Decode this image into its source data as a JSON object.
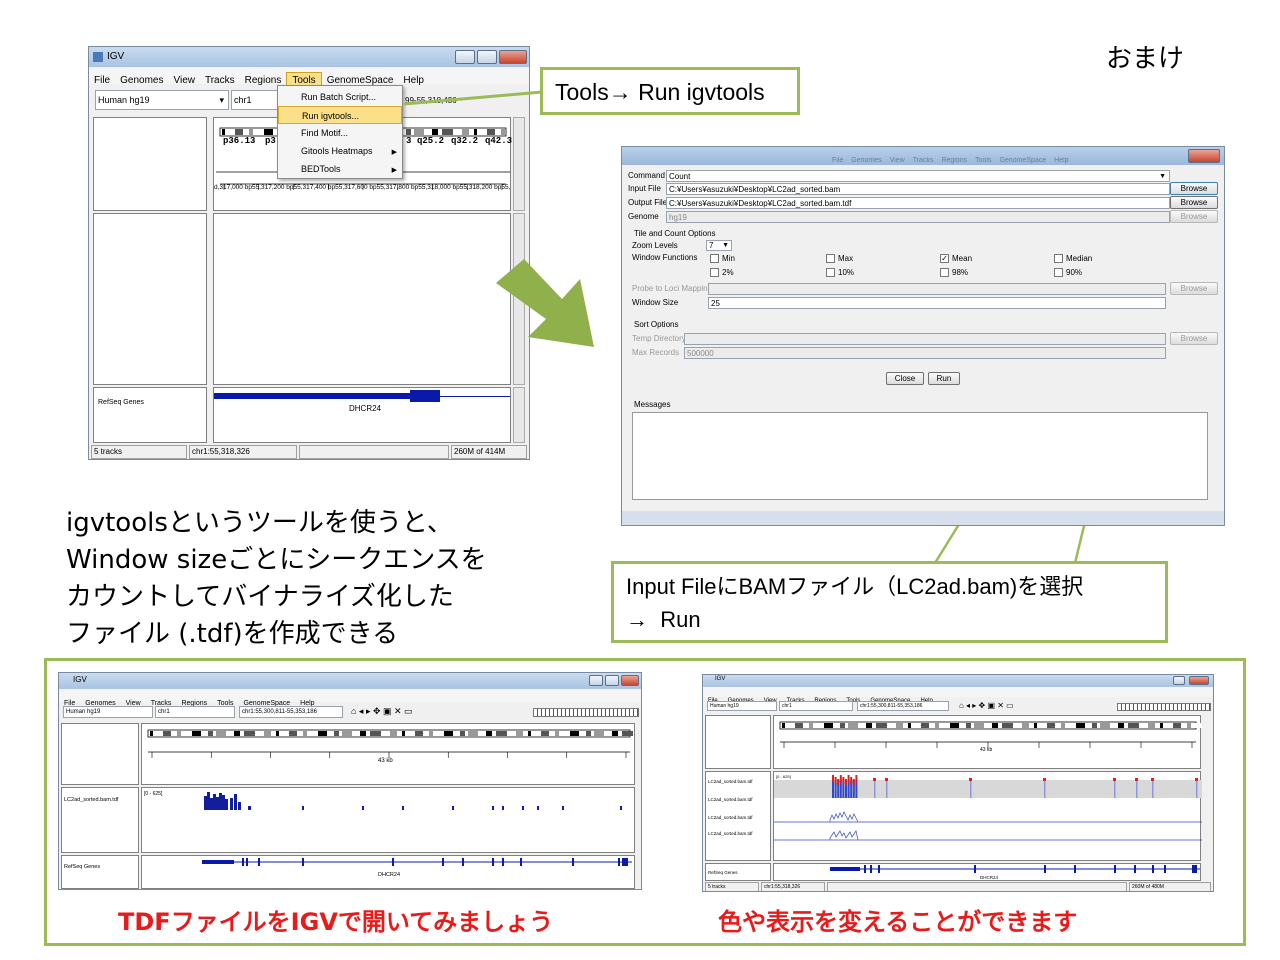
{
  "corner_label": "おまけ",
  "igv": {
    "title": "IGV",
    "menu": [
      "File",
      "Genomes",
      "View",
      "Tracks",
      "Regions",
      "Tools",
      "GenomeSpace",
      "Help"
    ],
    "genome": "Human hg19",
    "chrom": "chr1",
    "locus_partial": "99-55,318,436",
    "tools_menu": [
      "Run Batch Script...",
      "Run igvtools...",
      "Find Motif...",
      "Gitools Heatmaps",
      "BEDTools"
    ],
    "cyto_bands": [
      "p36.13",
      "p3",
      "3",
      "q25.2",
      "q32.2",
      "q42.3"
    ],
    "ruler_text": "d,317,000 bp55,317,200 bp55,317,400 bp55,317,600 bp55,317,800 bp55,318,000 bp55,318,200 bp55,318,40",
    "refseq_label": "RefSeq Genes",
    "gene": "DHCR24",
    "status": [
      "5 tracks",
      "chr1:55,318,326",
      "",
      "260M of 414M"
    ]
  },
  "callout_tools": "Tools→ Run igvtools",
  "dialog": {
    "bg_menu": [
      "File",
      "Genomes",
      "View",
      "Tracks",
      "Regions",
      "Tools",
      "GenomeSpace",
      "Help"
    ],
    "command_label": "Command",
    "command_value": "Count",
    "input_label": "Input File",
    "input_value": "C:¥Users¥asuzuki¥Desktop¥LC2ad_sorted.bam",
    "output_label": "Output File",
    "output_value": "C:¥Users¥asuzuki¥Desktop¥LC2ad_sorted.bam.tdf",
    "genome_label": "Genome",
    "genome_value": "hg19",
    "browse": "Browse",
    "tile_header": "Tile and Count Options",
    "zoom_label": "Zoom Levels",
    "zoom_value": "7",
    "window_functions_label": "Window Functions",
    "functions": [
      {
        "label": "Min",
        "checked": false
      },
      {
        "label": "Max",
        "checked": false
      },
      {
        "label": "Mean",
        "checked": true
      },
      {
        "label": "Median",
        "checked": false
      },
      {
        "label": "2%",
        "checked": false
      },
      {
        "label": "10%",
        "checked": false
      },
      {
        "label": "98%",
        "checked": false
      },
      {
        "label": "90%",
        "checked": false
      }
    ],
    "probe_label": "Probe to Loci Mapping",
    "window_size_label": "Window Size",
    "window_size_value": "25",
    "sort_header": "Sort Options",
    "temp_label": "Temp Directory",
    "maxrec_label": "Max Records",
    "maxrec_value": "500000",
    "close": "Close",
    "run": "Run",
    "messages_label": "Messages"
  },
  "description": "igvtoolsというツールを使うと、\nWindow sizeごとにシークエンスを\nカウントしてバイナライズ化した\nファイル (.tdf)を作成できる",
  "callout_input": "Input FileにBAMファイル（LC2ad.bam)を選択\n→  Run",
  "igv2": {
    "title": "IGV",
    "genome": "Human hg19",
    "chrom": "chr1",
    "locus": "chr1:55,300,811-55,353,186",
    "size_label": "43 kb",
    "track_label": "LC2ad_sorted.bam.tdf",
    "range": "[0 - 625]",
    "refseq_label": "RefSeq Genes",
    "gene": "DHCR24"
  },
  "igv3": {
    "title": "IGV",
    "genome": "Human hg19",
    "chrom": "chr1",
    "locus": "chr1:55,300,811-55,353,186",
    "size_label": "43 kb",
    "track_labels": [
      "LC2ad_sorted.bam.tdf",
      "LC2ad_sorted.bam.tdf",
      "LC2ad_sorted.bam.tdf",
      "LC2ad_sorted.bam.tdf"
    ],
    "range": "[0 - 625]",
    "refseq_label": "RefSeq Genes",
    "gene": "DHCR24",
    "status": [
      "5 tracks",
      "chr1:55,318,326",
      "",
      "260M of 480M"
    ]
  },
  "caption_left": "TDFファイルをIGVで開いてみましょう",
  "caption_right": "色や表示を変えることができます",
  "colors": {
    "callout_border": "#9bbb59",
    "arrow_green": "#8fb04a",
    "caption_red": "#e81a1a",
    "gene_blue": "#0a1aa8",
    "tdf_blue": "#141d9c",
    "tdf_red": "#e02020"
  }
}
